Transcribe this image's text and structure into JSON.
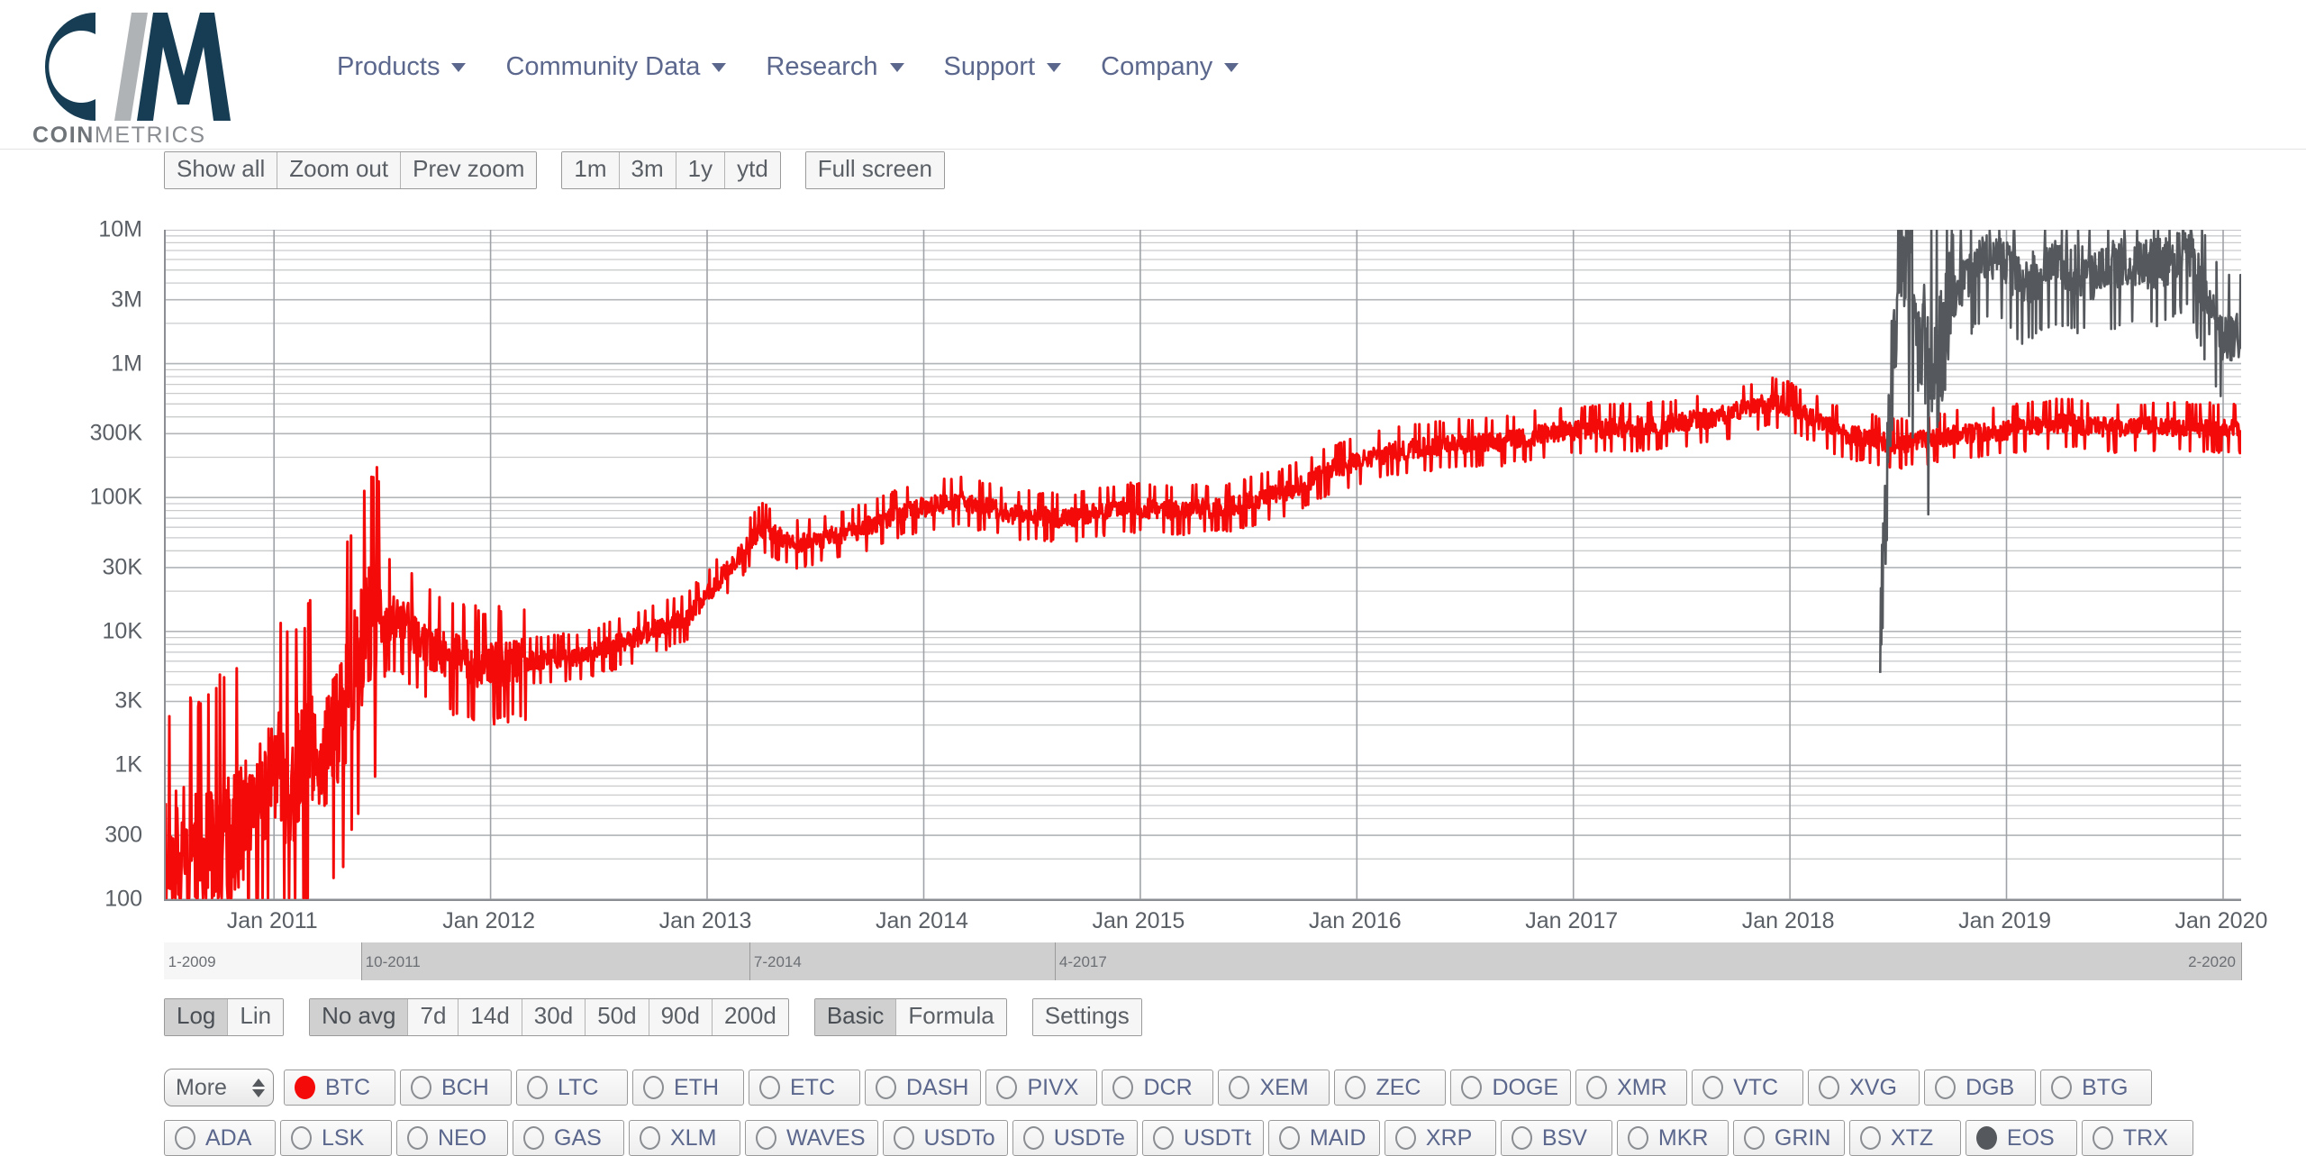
{
  "header": {
    "logo_alt": "CM",
    "wordmark_bold": "COIN",
    "wordmark_light": "METRICS",
    "nav": [
      {
        "label": "Products",
        "caret": "chevron-down-icon"
      },
      {
        "label": "Community Data",
        "caret": "chevron-down-icon"
      },
      {
        "label": "Research",
        "caret": "chevron-down-icon"
      },
      {
        "label": "Support",
        "caret": "chevron-down-icon"
      },
      {
        "label": "Company",
        "caret": "chevron-down-icon"
      }
    ]
  },
  "chart_toolbar": {
    "zoom_group": [
      "Show all",
      "Zoom out",
      "Prev zoom"
    ],
    "period_group": [
      "1m",
      "3m",
      "1y",
      "ytd"
    ],
    "fullscreen": [
      "Full screen"
    ]
  },
  "bottom_controls": {
    "scale_group": {
      "options": [
        "Log",
        "Lin"
      ],
      "selected": "Log"
    },
    "average_group": {
      "options": [
        "No avg",
        "7d",
        "14d",
        "30d",
        "50d",
        "90d",
        "200d"
      ],
      "selected": "No avg"
    },
    "mode_group": {
      "options": [
        "Basic",
        "Formula"
      ],
      "selected": "Basic"
    },
    "settings": "Settings"
  },
  "asset_selector": {
    "more_label": "More",
    "row1": [
      {
        "ticker": "BTC",
        "selected": true,
        "color": "#f50a0a"
      },
      {
        "ticker": "BCH",
        "selected": false
      },
      {
        "ticker": "LTC",
        "selected": false
      },
      {
        "ticker": "ETH",
        "selected": false
      },
      {
        "ticker": "ETC",
        "selected": false
      },
      {
        "ticker": "DASH",
        "selected": false
      },
      {
        "ticker": "PIVX",
        "selected": false
      },
      {
        "ticker": "DCR",
        "selected": false
      },
      {
        "ticker": "XEM",
        "selected": false
      },
      {
        "ticker": "ZEC",
        "selected": false
      },
      {
        "ticker": "DOGE",
        "selected": false
      },
      {
        "ticker": "XMR",
        "selected": false
      },
      {
        "ticker": "VTC",
        "selected": false
      },
      {
        "ticker": "XVG",
        "selected": false
      },
      {
        "ticker": "DGB",
        "selected": false
      },
      {
        "ticker": "BTG",
        "selected": false
      }
    ],
    "row2": [
      {
        "ticker": "ADA",
        "selected": false
      },
      {
        "ticker": "LSK",
        "selected": false
      },
      {
        "ticker": "NEO",
        "selected": false
      },
      {
        "ticker": "GAS",
        "selected": false
      },
      {
        "ticker": "XLM",
        "selected": false
      },
      {
        "ticker": "WAVES",
        "selected": false
      },
      {
        "ticker": "USDTo",
        "selected": false
      },
      {
        "ticker": "USDTe",
        "selected": false
      },
      {
        "ticker": "USDTt",
        "selected": false
      },
      {
        "ticker": "MAID",
        "selected": false
      },
      {
        "ticker": "XRP",
        "selected": false
      },
      {
        "ticker": "BSV",
        "selected": false
      },
      {
        "ticker": "MKR",
        "selected": false
      },
      {
        "ticker": "GRIN",
        "selected": false
      },
      {
        "ticker": "XTZ",
        "selected": false
      },
      {
        "ticker": "EOS",
        "selected": true,
        "color": "#55585c"
      },
      {
        "ticker": "TRX",
        "selected": false
      }
    ]
  },
  "range_selector": {
    "labels": [
      "1-2009",
      "10-2011",
      "7-2014",
      "4-2017",
      "2-2020"
    ],
    "selected_from": "10-2011",
    "selected_to": "2-2020",
    "selected_start_pct": 9.5,
    "selected_end_pct": 100
  },
  "chart_data": {
    "type": "line",
    "title": "",
    "xlabel": "",
    "ylabel": "",
    "yscale": "log",
    "ylim": [
      100,
      10000000
    ],
    "ytick_labels": [
      "10M",
      "3M",
      "1M",
      "300K",
      "100K",
      "30K",
      "10K",
      "3K",
      "1K",
      "300",
      "100"
    ],
    "ytick_values": [
      10000000,
      3000000,
      1000000,
      300000,
      100000,
      30000,
      10000,
      3000,
      1000,
      300,
      100
    ],
    "xtick_labels": [
      "Jan 2011",
      "Jan 2012",
      "Jan 2013",
      "Jan 2014",
      "Jan 2015",
      "Jan 2016",
      "Jan 2017",
      "Jan 2018",
      "Jan 2019",
      "Jan 2020"
    ],
    "xlim": [
      "2010-07",
      "2020-02"
    ],
    "grid": true,
    "legend_position": "none",
    "series": [
      {
        "name": "BTC",
        "color": "#f50a0a",
        "x": [
          "2010-07",
          "2010-08",
          "2010-09",
          "2010-10",
          "2010-11",
          "2010-12",
          "2011-01",
          "2011-02",
          "2011-03",
          "2011-04",
          "2011-05",
          "2011-06",
          "2011-07",
          "2011-08",
          "2011-09",
          "2011-10",
          "2011-11",
          "2011-12",
          "2012-01",
          "2012-03",
          "2012-06",
          "2012-09",
          "2012-12",
          "2013-03",
          "2013-04",
          "2013-06",
          "2013-09",
          "2013-12",
          "2014-03",
          "2014-06",
          "2014-09",
          "2014-12",
          "2015-03",
          "2015-06",
          "2015-09",
          "2015-12",
          "2016-03",
          "2016-06",
          "2016-09",
          "2016-12",
          "2017-03",
          "2017-06",
          "2017-09",
          "2017-12",
          "2018-01",
          "2018-04",
          "2018-07",
          "2018-10",
          "2019-01",
          "2019-04",
          "2019-07",
          "2019-10",
          "2020-01",
          "2020-02"
        ],
        "y": [
          200,
          260,
          230,
          300,
          340,
          420,
          900,
          700,
          1100,
          1500,
          3000,
          9500,
          12000,
          13500,
          9000,
          7000,
          6500,
          5800,
          5500,
          6000,
          6500,
          9000,
          13000,
          40000,
          60000,
          45000,
          55000,
          80000,
          95000,
          75000,
          70000,
          85000,
          80000,
          85000,
          110000,
          170000,
          220000,
          250000,
          260000,
          310000,
          330000,
          350000,
          400000,
          520000,
          480000,
          300000,
          250000,
          290000,
          320000,
          360000,
          330000,
          340000,
          330000,
          330000
        ]
      },
      {
        "name": "EOS",
        "color": "#55585c",
        "x": [
          "2018-06",
          "2018-06-15",
          "2018-07",
          "2018-07-15",
          "2018-08",
          "2018-09",
          "2018-10",
          "2018-11",
          "2018-12",
          "2019-01",
          "2019-02",
          "2019-03",
          "2019-04",
          "2019-05",
          "2019-06",
          "2019-07",
          "2019-08",
          "2019-09",
          "2019-10",
          "2019-11",
          "2019-12",
          "2020-01",
          "2020-02"
        ],
        "y": [
          10000,
          300000,
          6000000,
          9000000,
          2000000,
          800000,
          3000000,
          5000000,
          6500000,
          5500000,
          4000000,
          5000000,
          5500000,
          5000000,
          4500000,
          5500000,
          6000000,
          5500000,
          6000000,
          8000000,
          3000000,
          1500000,
          1600000
        ]
      }
    ]
  }
}
